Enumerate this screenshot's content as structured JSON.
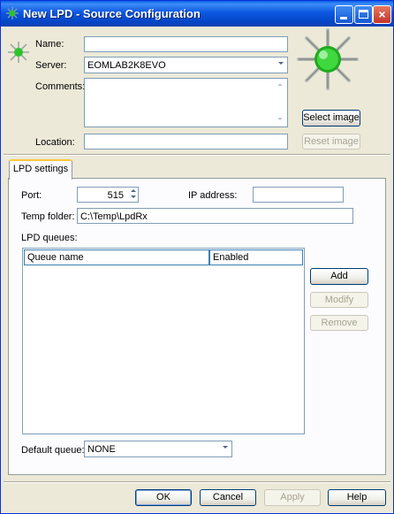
{
  "window": {
    "title": "New LPD - Source Configuration",
    "controls": {
      "minimize": "minimize",
      "maximize": "maximize",
      "close": "×"
    }
  },
  "source": {
    "name_label": "Name:",
    "name_value": "",
    "server_label": "Server:",
    "server_value": "EOMLAB2K8EVO",
    "comments_label": "Comments:",
    "comments_value": "",
    "location_label": "Location:",
    "location_value": "",
    "select_image_label": "Select image",
    "reset_image_label": "Reset image"
  },
  "tabs": [
    {
      "label": "LPD settings",
      "selected": true
    }
  ],
  "lpd": {
    "port_label": "Port:",
    "port_value": "515",
    "ip_label": "IP address:",
    "ip_value": "",
    "temp_folder_label": "Temp folder:",
    "temp_folder_value": "C:\\Temp\\LpdRx",
    "queues_label": "LPD queues:",
    "columns": [
      "Queue name",
      "Enabled"
    ],
    "rows": [],
    "add_label": "Add",
    "modify_label": "Modify",
    "remove_label": "Remove",
    "default_queue_label": "Default queue:",
    "default_queue_value": "NONE"
  },
  "footer": {
    "ok_label": "OK",
    "cancel_label": "Cancel",
    "apply_label": "Apply",
    "help_label": "Help"
  },
  "icons": {
    "title": "source-star-icon",
    "small": "source-star-icon",
    "large": "source-star-large-icon"
  },
  "colors": {
    "titlebar": "#0c58e2",
    "face": "#ece9d8",
    "icon_green": "#2ec22e",
    "tab_highlight": "#ffc83c"
  }
}
